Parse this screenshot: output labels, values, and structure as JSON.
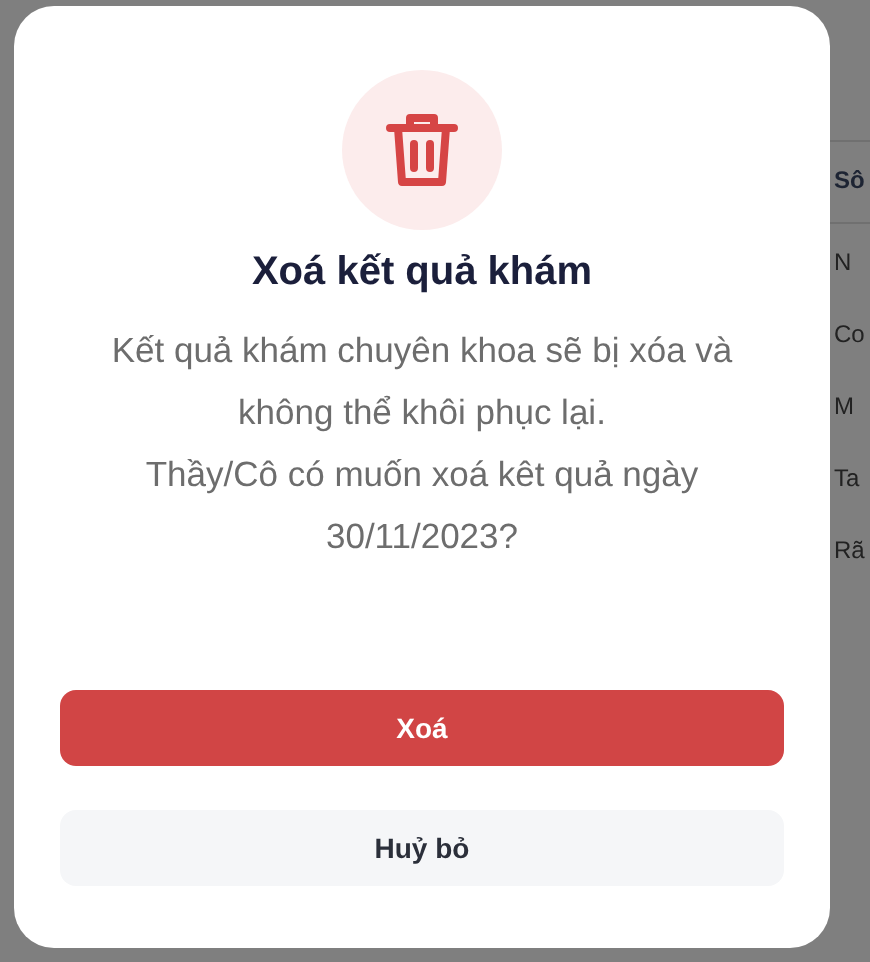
{
  "background_column_fragments": [
    "Sô",
    "N",
    "Co",
    "M",
    "Ta",
    "Rã"
  ],
  "dialog": {
    "title": "Xoá kết quả khám",
    "message": [
      "Kết quả khám chuyên khoa sẽ bị xóa và không thể khôi phục lại.",
      "Thầy/Cô có muốn xoá kêt quả ngày 30/11/2023?"
    ],
    "buttons": [
      {
        "label": "Xoá",
        "kind": "primary"
      },
      {
        "label": "Huỷ bỏ",
        "kind": "secondary"
      }
    ]
  }
}
